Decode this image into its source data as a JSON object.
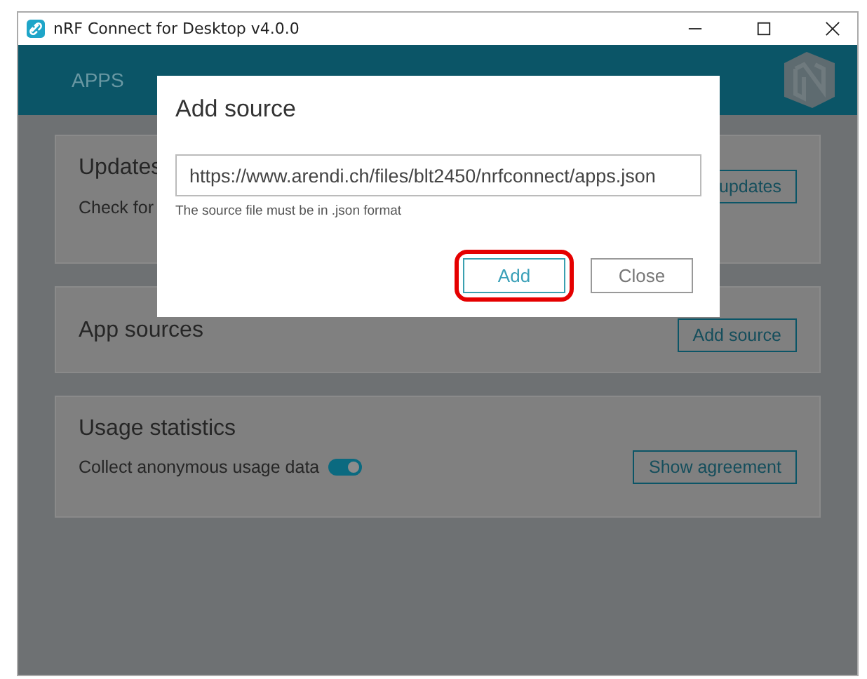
{
  "window": {
    "title": "nRF Connect for Desktop v4.0.0"
  },
  "tabs": [
    {
      "label": "APPS",
      "selected": false
    }
  ],
  "cards": [
    {
      "kind": "updates",
      "title": "Updates",
      "text": "Check for",
      "button": "updates"
    },
    {
      "kind": "sources",
      "title": "App sources",
      "button": "Add source"
    },
    {
      "kind": "usage",
      "title": "Usage statistics",
      "text": "Collect anonymous usage data",
      "toggle_on": true,
      "button": "Show agreement"
    }
  ],
  "dialog": {
    "title": "Add source",
    "value": "https://www.arendi.ch/files/blt2450/nrfconnect/apps.json",
    "hint": "The source file must be in .json format",
    "buttons": [
      {
        "label": "Add",
        "primary": true,
        "highlighted": true
      },
      {
        "label": "Close",
        "primary": false,
        "highlighted": false
      }
    ]
  }
}
